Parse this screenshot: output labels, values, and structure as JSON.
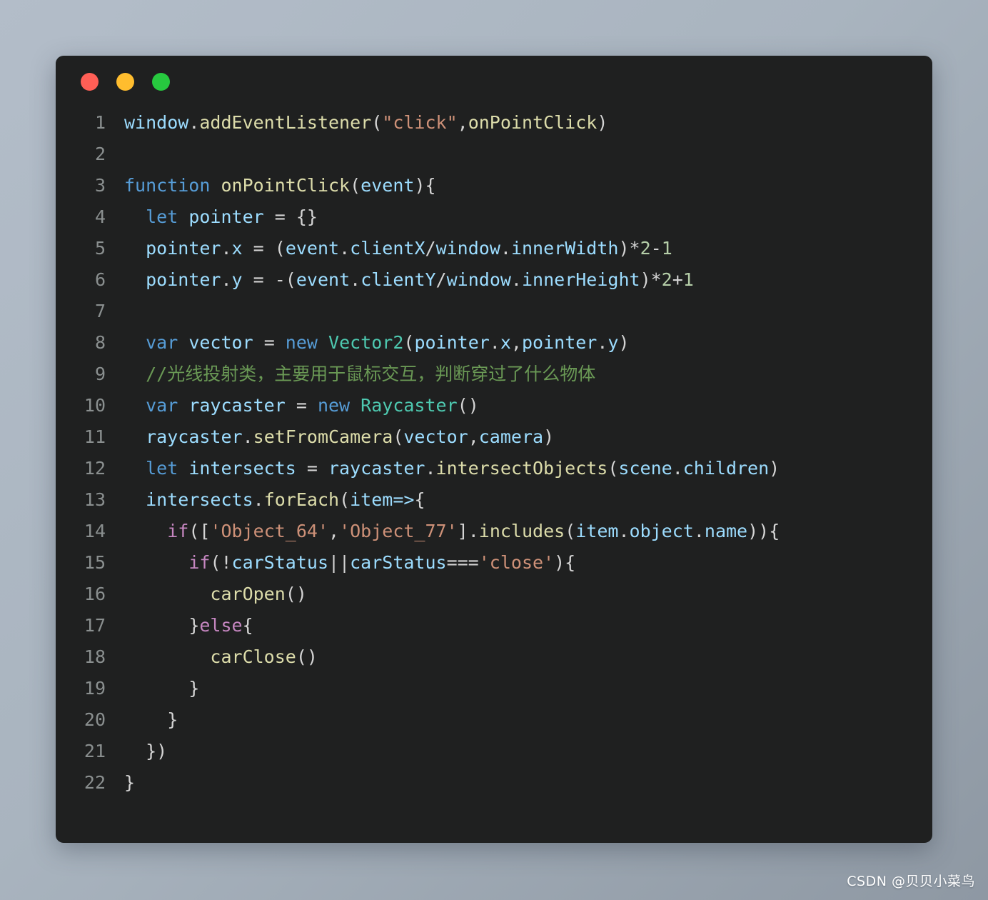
{
  "window": {
    "title_bar": {
      "buttons": [
        {
          "name": "close-button",
          "label": "",
          "color": "#ff5f56"
        },
        {
          "name": "minimize-button",
          "label": "",
          "color": "#ffbd2e"
        },
        {
          "name": "maximize-button",
          "label": "",
          "color": "#27c93f"
        }
      ]
    },
    "background": "#1f2020"
  },
  "editor": {
    "language": "javascript",
    "first_line_number": 1,
    "total_lines": 22,
    "lines": [
      {
        "number": "1",
        "text": "window.addEventListener(\"click\",onPointClick)",
        "tokens": [
          {
            "t": "window",
            "c": "var"
          },
          {
            "t": ".",
            "c": "pun"
          },
          {
            "t": "addEventListener",
            "c": "fn"
          },
          {
            "t": "(",
            "c": "pun"
          },
          {
            "t": "\"click\"",
            "c": "str"
          },
          {
            "t": ",",
            "c": "pun"
          },
          {
            "t": "onPointClick",
            "c": "fn"
          },
          {
            "t": ")",
            "c": "pun"
          }
        ]
      },
      {
        "number": "2",
        "text": "",
        "tokens": []
      },
      {
        "number": "3",
        "text": "function onPointClick(event){",
        "tokens": [
          {
            "t": "function",
            "c": "kw"
          },
          {
            "t": " ",
            "c": "pun"
          },
          {
            "t": "onPointClick",
            "c": "fn"
          },
          {
            "t": "(",
            "c": "pun"
          },
          {
            "t": "event",
            "c": "var"
          },
          {
            "t": "){",
            "c": "pun"
          }
        ]
      },
      {
        "number": "4",
        "text": "  let pointer = {}",
        "tokens": [
          {
            "t": "  ",
            "c": "pun"
          },
          {
            "t": "let",
            "c": "kw"
          },
          {
            "t": " ",
            "c": "pun"
          },
          {
            "t": "pointer",
            "c": "var"
          },
          {
            "t": " = ",
            "c": "op"
          },
          {
            "t": "{}",
            "c": "pun"
          }
        ]
      },
      {
        "number": "5",
        "text": "  pointer.x = (event.clientX/window.innerWidth)*2-1",
        "tokens": [
          {
            "t": "  ",
            "c": "pun"
          },
          {
            "t": "pointer",
            "c": "var"
          },
          {
            "t": ".",
            "c": "pun"
          },
          {
            "t": "x",
            "c": "var"
          },
          {
            "t": " = ",
            "c": "op"
          },
          {
            "t": "(",
            "c": "pun"
          },
          {
            "t": "event",
            "c": "var"
          },
          {
            "t": ".",
            "c": "pun"
          },
          {
            "t": "clientX",
            "c": "var"
          },
          {
            "t": "/",
            "c": "pun"
          },
          {
            "t": "window",
            "c": "var"
          },
          {
            "t": ".",
            "c": "pun"
          },
          {
            "t": "innerWidth",
            "c": "var"
          },
          {
            "t": ")*",
            "c": "pun"
          },
          {
            "t": "2",
            "c": "num"
          },
          {
            "t": "-",
            "c": "pun"
          },
          {
            "t": "1",
            "c": "num"
          }
        ]
      },
      {
        "number": "6",
        "text": "  pointer.y = -(event.clientY/window.innerHeight)*2+1",
        "tokens": [
          {
            "t": "  ",
            "c": "pun"
          },
          {
            "t": "pointer",
            "c": "var"
          },
          {
            "t": ".",
            "c": "pun"
          },
          {
            "t": "y",
            "c": "var"
          },
          {
            "t": " = -(",
            "c": "pun"
          },
          {
            "t": "event",
            "c": "var"
          },
          {
            "t": ".",
            "c": "pun"
          },
          {
            "t": "clientY",
            "c": "var"
          },
          {
            "t": "/",
            "c": "pun"
          },
          {
            "t": "window",
            "c": "var"
          },
          {
            "t": ".",
            "c": "pun"
          },
          {
            "t": "innerHeight",
            "c": "var"
          },
          {
            "t": ")*",
            "c": "pun"
          },
          {
            "t": "2",
            "c": "num"
          },
          {
            "t": "+",
            "c": "pun"
          },
          {
            "t": "1",
            "c": "num"
          }
        ]
      },
      {
        "number": "7",
        "text": "",
        "tokens": []
      },
      {
        "number": "8",
        "text": "  var vector = new Vector2(pointer.x,pointer.y)",
        "tokens": [
          {
            "t": "  ",
            "c": "pun"
          },
          {
            "t": "var",
            "c": "kw"
          },
          {
            "t": " ",
            "c": "pun"
          },
          {
            "t": "vector",
            "c": "var"
          },
          {
            "t": " = ",
            "c": "op"
          },
          {
            "t": "new",
            "c": "kw"
          },
          {
            "t": " ",
            "c": "pun"
          },
          {
            "t": "Vector2",
            "c": "cls"
          },
          {
            "t": "(",
            "c": "pun"
          },
          {
            "t": "pointer",
            "c": "var"
          },
          {
            "t": ".",
            "c": "pun"
          },
          {
            "t": "x",
            "c": "var"
          },
          {
            "t": ",",
            "c": "pun"
          },
          {
            "t": "pointer",
            "c": "var"
          },
          {
            "t": ".",
            "c": "pun"
          },
          {
            "t": "y",
            "c": "var"
          },
          {
            "t": ")",
            "c": "pun"
          }
        ]
      },
      {
        "number": "9",
        "text": "  //光线投射类，主要用于鼠标交互，判断穿过了什么物体",
        "tokens": [
          {
            "t": "  ",
            "c": "pun"
          },
          {
            "t": "//光线投射类，主要用于鼠标交互，判断穿过了什么物体",
            "c": "cmt"
          }
        ]
      },
      {
        "number": "10",
        "text": "  var raycaster = new Raycaster()",
        "tokens": [
          {
            "t": "  ",
            "c": "pun"
          },
          {
            "t": "var",
            "c": "kw"
          },
          {
            "t": " ",
            "c": "pun"
          },
          {
            "t": "raycaster",
            "c": "var"
          },
          {
            "t": " = ",
            "c": "op"
          },
          {
            "t": "new",
            "c": "kw"
          },
          {
            "t": " ",
            "c": "pun"
          },
          {
            "t": "Raycaster",
            "c": "cls"
          },
          {
            "t": "()",
            "c": "pun"
          }
        ]
      },
      {
        "number": "11",
        "text": "  raycaster.setFromCamera(vector,camera)",
        "tokens": [
          {
            "t": "  ",
            "c": "pun"
          },
          {
            "t": "raycaster",
            "c": "var"
          },
          {
            "t": ".",
            "c": "pun"
          },
          {
            "t": "setFromCamera",
            "c": "fn"
          },
          {
            "t": "(",
            "c": "pun"
          },
          {
            "t": "vector",
            "c": "var"
          },
          {
            "t": ",",
            "c": "pun"
          },
          {
            "t": "camera",
            "c": "var"
          },
          {
            "t": ")",
            "c": "pun"
          }
        ]
      },
      {
        "number": "12",
        "text": "  let intersects = raycaster.intersectObjects(scene.children)",
        "tokens": [
          {
            "t": "  ",
            "c": "pun"
          },
          {
            "t": "let",
            "c": "kw"
          },
          {
            "t": " ",
            "c": "pun"
          },
          {
            "t": "intersects",
            "c": "var"
          },
          {
            "t": " = ",
            "c": "op"
          },
          {
            "t": "raycaster",
            "c": "var"
          },
          {
            "t": ".",
            "c": "pun"
          },
          {
            "t": "intersectObjects",
            "c": "fn"
          },
          {
            "t": "(",
            "c": "pun"
          },
          {
            "t": "scene",
            "c": "var"
          },
          {
            "t": ".",
            "c": "pun"
          },
          {
            "t": "children",
            "c": "var"
          },
          {
            "t": ")",
            "c": "pun"
          }
        ]
      },
      {
        "number": "13",
        "text": "  intersects.forEach(item=>{",
        "tokens": [
          {
            "t": "  ",
            "c": "pun"
          },
          {
            "t": "intersects",
            "c": "var"
          },
          {
            "t": ".",
            "c": "pun"
          },
          {
            "t": "forEach",
            "c": "fn"
          },
          {
            "t": "(",
            "c": "pun"
          },
          {
            "t": "item",
            "c": "var"
          },
          {
            "t": "=>",
            "c": "var"
          },
          {
            "t": "{",
            "c": "pun"
          }
        ]
      },
      {
        "number": "14",
        "text": "    if(['Object_64','Object_77'].includes(item.object.name)){",
        "tokens": [
          {
            "t": "    ",
            "c": "pun"
          },
          {
            "t": "if",
            "c": "ctl"
          },
          {
            "t": "([",
            "c": "pun"
          },
          {
            "t": "'Object_64'",
            "c": "str"
          },
          {
            "t": ",",
            "c": "pun"
          },
          {
            "t": "'Object_77'",
            "c": "str"
          },
          {
            "t": "].",
            "c": "pun"
          },
          {
            "t": "includes",
            "c": "fn"
          },
          {
            "t": "(",
            "c": "pun"
          },
          {
            "t": "item",
            "c": "var"
          },
          {
            "t": ".",
            "c": "pun"
          },
          {
            "t": "object",
            "c": "var"
          },
          {
            "t": ".",
            "c": "pun"
          },
          {
            "t": "name",
            "c": "var"
          },
          {
            "t": ")){",
            "c": "pun"
          }
        ]
      },
      {
        "number": "15",
        "text": "      if(!carStatus||carStatus==='close'){",
        "tokens": [
          {
            "t": "      ",
            "c": "pun"
          },
          {
            "t": "if",
            "c": "ctl"
          },
          {
            "t": "(!",
            "c": "pun"
          },
          {
            "t": "carStatus",
            "c": "var"
          },
          {
            "t": "||",
            "c": "pun"
          },
          {
            "t": "carStatus",
            "c": "var"
          },
          {
            "t": "===",
            "c": "op"
          },
          {
            "t": "'close'",
            "c": "str"
          },
          {
            "t": "){",
            "c": "pun"
          }
        ]
      },
      {
        "number": "16",
        "text": "        carOpen()",
        "tokens": [
          {
            "t": "        ",
            "c": "pun"
          },
          {
            "t": "carOpen",
            "c": "fn"
          },
          {
            "t": "()",
            "c": "pun"
          }
        ]
      },
      {
        "number": "17",
        "text": "      }else{",
        "tokens": [
          {
            "t": "      ",
            "c": "pun"
          },
          {
            "t": "}",
            "c": "pun"
          },
          {
            "t": "else",
            "c": "ctl"
          },
          {
            "t": "{",
            "c": "pun"
          }
        ]
      },
      {
        "number": "18",
        "text": "        carClose()",
        "tokens": [
          {
            "t": "        ",
            "c": "pun"
          },
          {
            "t": "carClose",
            "c": "fn"
          },
          {
            "t": "()",
            "c": "pun"
          }
        ]
      },
      {
        "number": "19",
        "text": "      }",
        "tokens": [
          {
            "t": "      }",
            "c": "pun"
          }
        ]
      },
      {
        "number": "20",
        "text": "    }",
        "tokens": [
          {
            "t": "    }",
            "c": "pun"
          }
        ]
      },
      {
        "number": "21",
        "text": "  })",
        "tokens": [
          {
            "t": "  })",
            "c": "pun"
          }
        ]
      },
      {
        "number": "22",
        "text": "}",
        "tokens": [
          {
            "t": "}",
            "c": "pun"
          }
        ]
      }
    ]
  },
  "watermark": {
    "text": "CSDN @贝贝小菜鸟"
  },
  "theme": {
    "background_gradient_start": "#b3bdc9",
    "background_gradient_end": "#8e98a3",
    "panel_background": "#1f2020",
    "line_number_color": "#8a8f8f",
    "keyword_color": "#569cd6",
    "control_keyword_color": "#c586c0",
    "function_color": "#dcdcaa",
    "identifier_color": "#9cdcfe",
    "class_color": "#4ec9b0",
    "string_color": "#ce9178",
    "number_color": "#b5cea8",
    "comment_color": "#6a9955",
    "punctuation_color": "#d4d4d4"
  }
}
